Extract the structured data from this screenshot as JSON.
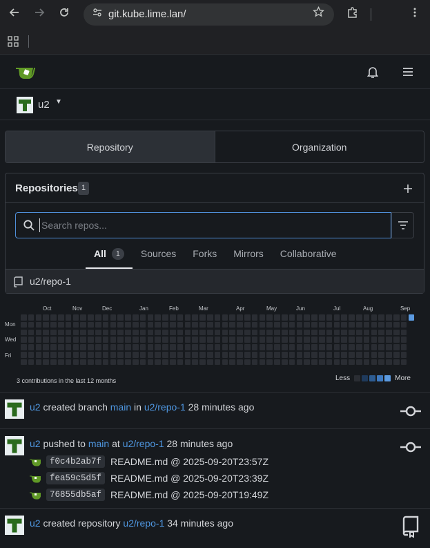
{
  "browser": {
    "url": "git.kube.lime.lan/",
    "nav_icons": [
      "back-arrow-icon",
      "forward-arrow-icon",
      "reload-icon"
    ],
    "right_icons": [
      "extensions-icon",
      "more-menu-icon"
    ]
  },
  "context": {
    "user": "u2"
  },
  "tabs": {
    "repository": "Repository",
    "organization": "Organization"
  },
  "repos": {
    "title": "Repositories",
    "count": "1",
    "search_placeholder": "Search repos...",
    "filters": {
      "all": "All",
      "all_count": "1",
      "sources": "Sources",
      "forks": "Forks",
      "mirrors": "Mirrors",
      "collaborative": "Collaborative"
    },
    "items": [
      {
        "name": "u2/repo-1"
      }
    ]
  },
  "heatmap": {
    "months": [
      "Oct",
      "Nov",
      "Dec",
      "Jan",
      "Feb",
      "Mar",
      "Apr",
      "May",
      "Jun",
      "Jul",
      "Aug",
      "Sep"
    ],
    "days": [
      "Mon",
      "Wed",
      "Fri"
    ],
    "summary": "3 contributions in the last 12 months",
    "legend_less": "Less",
    "legend_more": "More",
    "legend_colors": [
      "#2a2d33",
      "#1f3a5c",
      "#2d5c92",
      "#3e7ac0",
      "#5b9ae0"
    ],
    "active_color": "#5b9ae0"
  },
  "feed": [
    {
      "user": "u2",
      "action": "created branch",
      "target": "main",
      "joiner": "in",
      "repo": "u2/repo-1",
      "time": "28 minutes ago"
    },
    {
      "user": "u2",
      "action": "pushed to",
      "target": "main",
      "joiner": "at",
      "repo": "u2/repo-1",
      "time": "28 minutes ago",
      "commits": [
        {
          "sha": "f0c4b2ab7f",
          "message": "README.md @ 2025-09-20T23:57Z"
        },
        {
          "sha": "fea59c5d5f",
          "message": "README.md @ 2025-09-20T23:39Z"
        },
        {
          "sha": "76855db5af",
          "message": "README.md @ 2025-09-20T19:49Z"
        }
      ]
    },
    {
      "user": "u2",
      "action": "created repository",
      "repo": "u2/repo-1",
      "time": "34 minutes ago"
    }
  ]
}
